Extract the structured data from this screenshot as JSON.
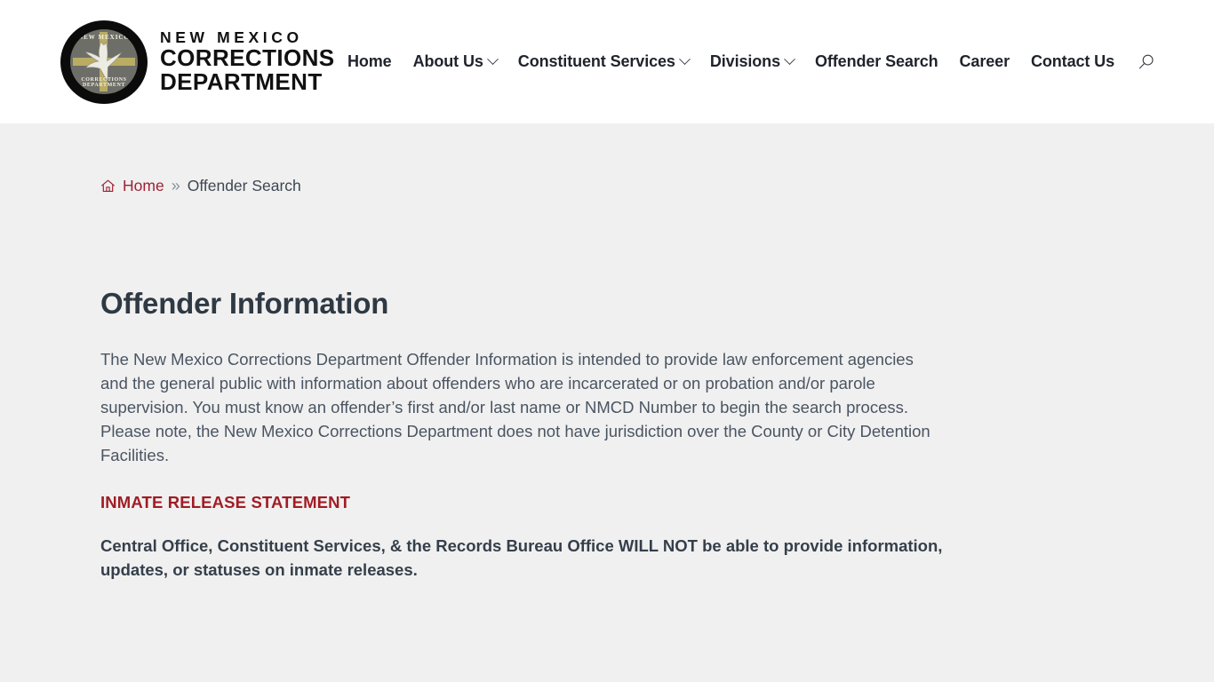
{
  "header": {
    "logo": {
      "icon": "nmcd-seal-icon",
      "seal_top_text": "NEW MEXICO",
      "seal_bottom_text": "CORRECTIONS DEPARTMENT",
      "wordmark_line1": "NEW MEXICO",
      "wordmark_line2": "CORRECTIONS",
      "wordmark_line3": "DEPARTMENT"
    },
    "nav": [
      {
        "label": "Home",
        "has_dropdown": false
      },
      {
        "label": "About Us",
        "has_dropdown": true
      },
      {
        "label": "Constituent Services",
        "has_dropdown": true
      },
      {
        "label": "Divisions",
        "has_dropdown": true
      },
      {
        "label": "Offender Search",
        "has_dropdown": false
      },
      {
        "label": "Career",
        "has_dropdown": false
      },
      {
        "label": "Contact Us",
        "has_dropdown": false
      }
    ],
    "search": {
      "icon": "search-icon",
      "label": "Search"
    }
  },
  "breadcrumb": {
    "home_icon": "home-icon",
    "home_label": "Home",
    "separator": "»",
    "current": "Offender Search"
  },
  "main": {
    "heading": "Offender Information",
    "intro_paragraph": "The New Mexico Corrections Department Offender Information is intended to provide law enforcement agencies and the general public with information about offenders who are incarcerated or on probation and/or parole supervision. You must know an offender’s first and/or last name or NMCD Number to begin the search process. Please note, the New Mexico Corrections Department does not have jurisdiction over the County or City Detention Facilities.",
    "release_statement_title": "INMATE RELEASE STATEMENT",
    "release_statement_body": "Central Office, Constituent Services, & the Records Bureau Office WILL NOT be able to provide information, updates, or statuses on inmate releases."
  },
  "colors": {
    "header_bg": "#ffffff",
    "page_bg": "#f0f0f0",
    "accent_red": "#9d2235",
    "heading": "#2f3943",
    "body_text": "#4a5562",
    "nav_text": "#1f232b",
    "seal_ring": "#0b0b0b",
    "seal_field": "#6e6e68",
    "seal_cross": "#b9ac63"
  }
}
